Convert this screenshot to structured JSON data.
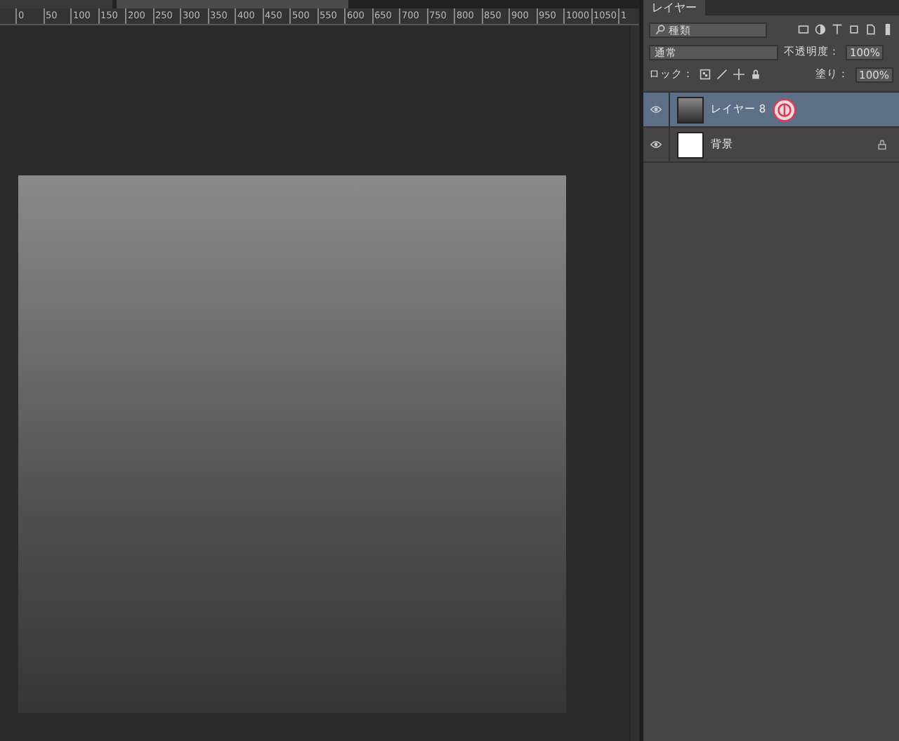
{
  "ruler": {
    "ticks": [
      "0",
      "50",
      "100",
      "150",
      "200",
      "250",
      "300",
      "350",
      "400",
      "450",
      "500",
      "550",
      "600",
      "650",
      "700",
      "750",
      "800",
      "850",
      "900",
      "950",
      "1000",
      "1050",
      "1"
    ]
  },
  "layers_panel": {
    "tab": "レイヤー",
    "filter": "種類",
    "blend_mode": "通常",
    "opacity_label": "不透明度：",
    "opacity": "100%",
    "lock_label": "ロック：",
    "fill_label": "塗り：",
    "fill": "100%"
  },
  "layers": [
    {
      "name": "レイヤー 8",
      "kind": "gradient",
      "selected": true,
      "visible": true,
      "locked": false,
      "annotated": true
    },
    {
      "name": "背景",
      "kind": "white",
      "selected": false,
      "visible": true,
      "locked": true,
      "annotated": false
    }
  ]
}
